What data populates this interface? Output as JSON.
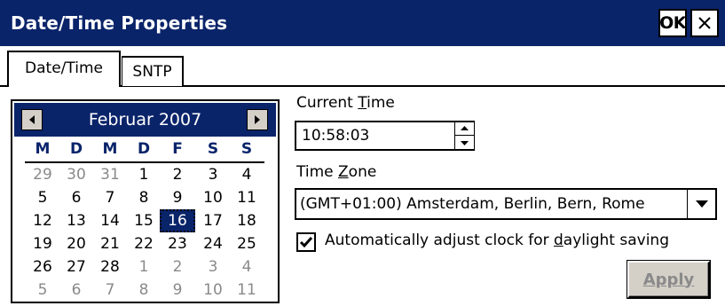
{
  "window": {
    "title": "Date/Time Properties",
    "ok_label": "OK",
    "close_icon": "close-icon"
  },
  "tabs": [
    {
      "label": "Date/Time",
      "active": true
    },
    {
      "label": "SNTP",
      "active": false
    }
  ],
  "calendar": {
    "month_label": "Februar 2007",
    "prev_icon": "left-arrow-icon",
    "next_icon": "right-arrow-icon",
    "weekdays": [
      "M",
      "D",
      "M",
      "D",
      "F",
      "S",
      "S"
    ],
    "weeks": [
      [
        {
          "d": "29",
          "o": true
        },
        {
          "d": "30",
          "o": true
        },
        {
          "d": "31",
          "o": true
        },
        {
          "d": "1"
        },
        {
          "d": "2"
        },
        {
          "d": "3"
        },
        {
          "d": "4"
        }
      ],
      [
        {
          "d": "5"
        },
        {
          "d": "6"
        },
        {
          "d": "7"
        },
        {
          "d": "8"
        },
        {
          "d": "9"
        },
        {
          "d": "10"
        },
        {
          "d": "11"
        }
      ],
      [
        {
          "d": "12"
        },
        {
          "d": "13"
        },
        {
          "d": "14"
        },
        {
          "d": "15"
        },
        {
          "d": "16",
          "sel": true
        },
        {
          "d": "17"
        },
        {
          "d": "18"
        }
      ],
      [
        {
          "d": "19"
        },
        {
          "d": "20"
        },
        {
          "d": "21"
        },
        {
          "d": "22"
        },
        {
          "d": "23"
        },
        {
          "d": "24"
        },
        {
          "d": "25"
        }
      ],
      [
        {
          "d": "26"
        },
        {
          "d": "27"
        },
        {
          "d": "28"
        },
        {
          "d": "1",
          "o": true
        },
        {
          "d": "2",
          "o": true
        },
        {
          "d": "3",
          "o": true
        },
        {
          "d": "4",
          "o": true
        }
      ],
      [
        {
          "d": "5",
          "o": true
        },
        {
          "d": "6",
          "o": true
        },
        {
          "d": "7",
          "o": true
        },
        {
          "d": "8",
          "o": true
        },
        {
          "d": "9",
          "o": true
        },
        {
          "d": "10",
          "o": true
        },
        {
          "d": "11",
          "o": true
        }
      ]
    ]
  },
  "current_time": {
    "label_prefix": "Current ",
    "label_accel": "T",
    "label_rest": "ime",
    "value": "10:58:03"
  },
  "time_zone": {
    "label_prefix": "Time ",
    "label_accel": "Z",
    "label_rest": "one",
    "value": "(GMT+01:00) Amsterdam, Berlin, Bern, Rome"
  },
  "daylight": {
    "checked": true,
    "label_prefix": "Automatically adjust clock for ",
    "label_accel": "d",
    "label_rest": "aylight saving"
  },
  "apply_button": {
    "label": "Apply",
    "enabled": false
  },
  "colors": {
    "title_bar": "#0a246a",
    "disabled_text": "#8a8a8a"
  }
}
